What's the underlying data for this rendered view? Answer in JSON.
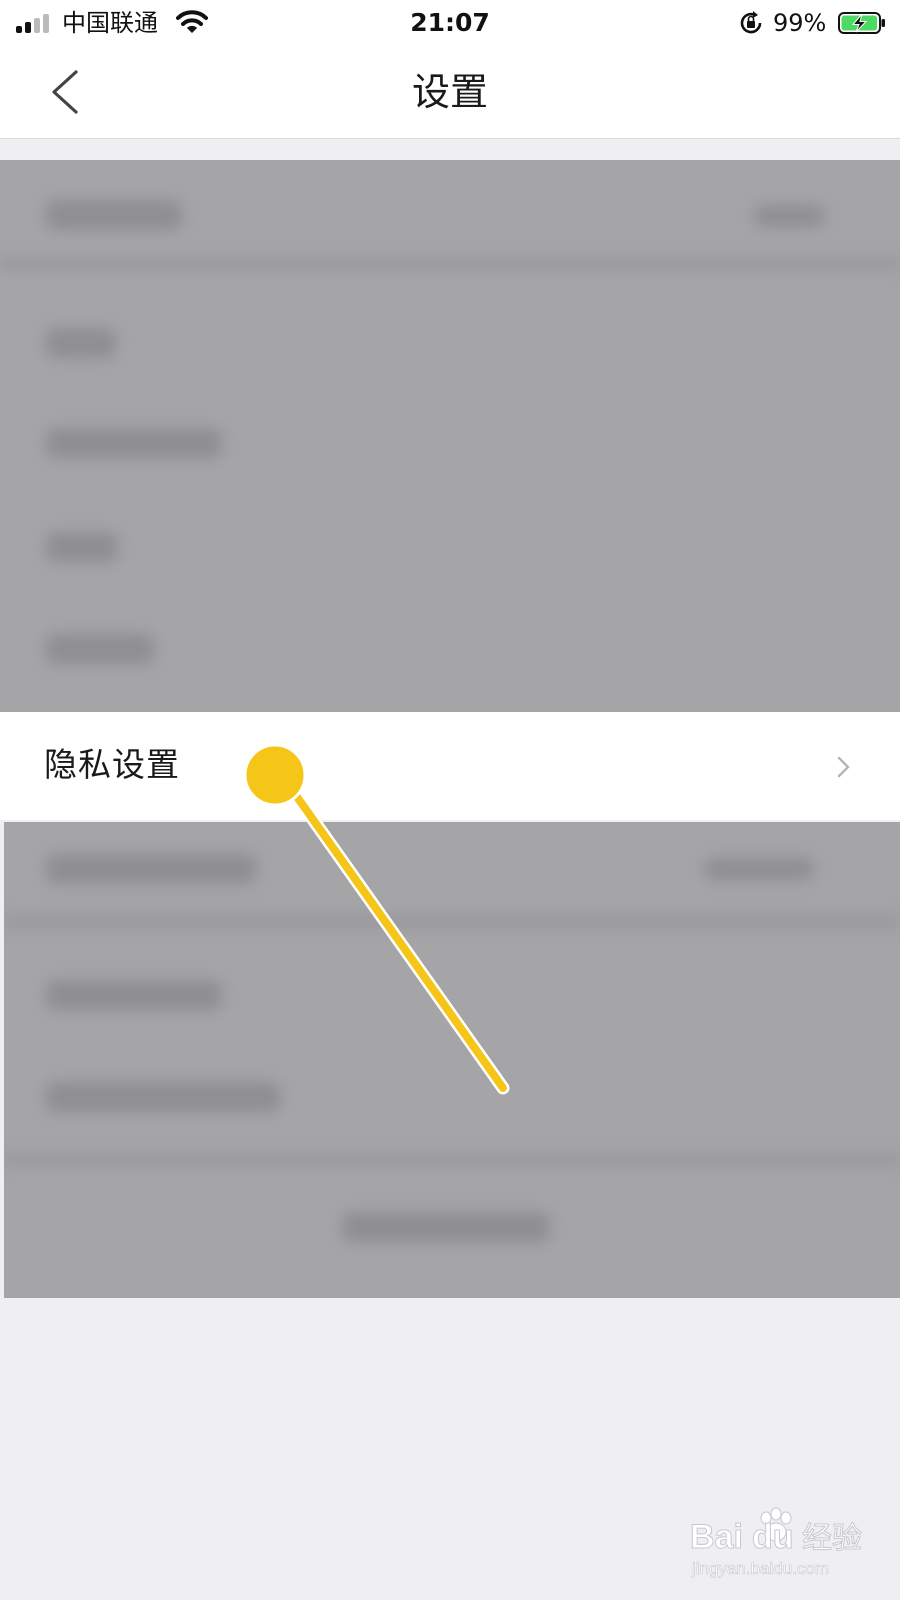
{
  "status_bar": {
    "carrier": "中国联通",
    "time": "21:07",
    "battery_percent": "99%",
    "battery_level": 0.99,
    "signal_bars_filled": 2,
    "colors": {
      "battery_charging": "#4cd964"
    }
  },
  "nav": {
    "title": "设置",
    "back_icon": "chevron-left-icon"
  },
  "settings": {
    "privacy_item": {
      "label": "隐私设置",
      "icon": "chevron-right-icon"
    }
  },
  "annotation": {
    "pointer_color": "#f5c518"
  },
  "watermark": {
    "brand": "Bai",
    "brand2": "du",
    "product": "经验",
    "url": "jingyan.baidu.com"
  }
}
